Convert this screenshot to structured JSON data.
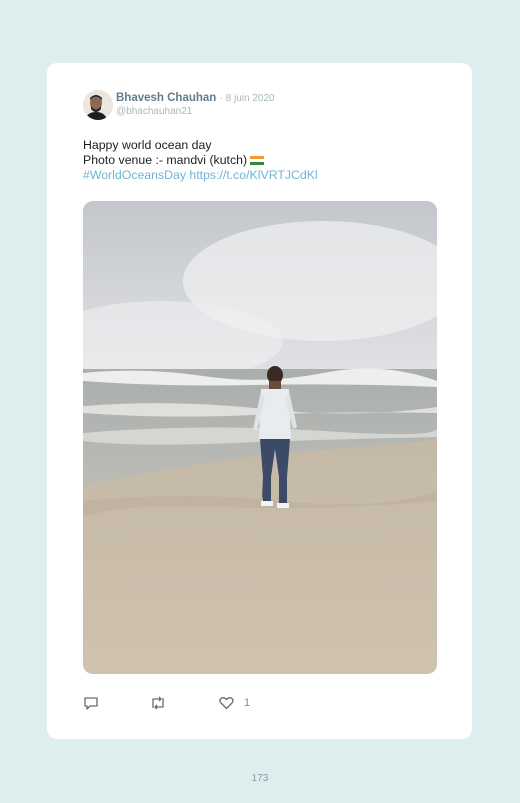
{
  "tweet": {
    "author_name": "Bhavesh Chauhan",
    "date": "· 8 juin 2020",
    "handle": "@bhachauhan21",
    "line1": "Happy world ocean day",
    "line2": "Photo venue :- mandvi (kutch)",
    "hashtag": "#WorldOceansDay",
    "url": "https://t.co/KlVRTJCdKl",
    "likes": "1"
  },
  "icons": {
    "reply": "reply-icon",
    "retweet": "retweet-icon",
    "like": "heart-icon",
    "flag": "india-flag-icon"
  },
  "colors": {
    "background": "#dcefee",
    "author": "#5f7d8e",
    "link": "#6fb4d6"
  },
  "footer": {
    "page_number": "173"
  }
}
